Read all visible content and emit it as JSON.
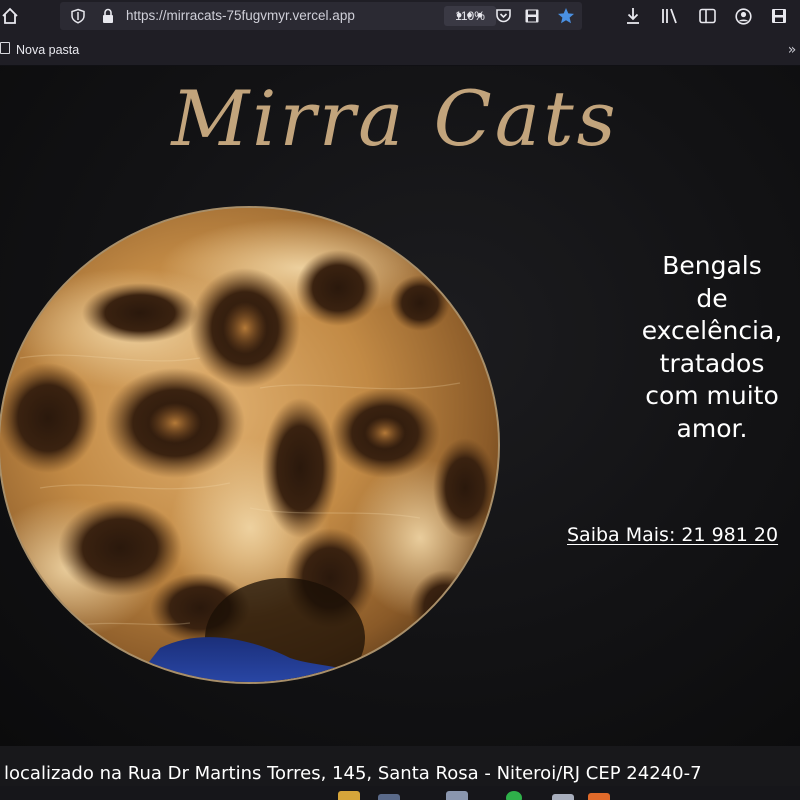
{
  "browser": {
    "url": "https://mirracats-75fugvmyr.vercel.app",
    "zoom": "110%",
    "bookmark_folder": "Nova pasta",
    "icons": [
      "home-icon",
      "shield-icon",
      "lock-icon",
      "more-icon",
      "pocket-icon",
      "save-icon",
      "star-icon",
      "download-icon",
      "library-icon",
      "sidebar-icon",
      "account-icon",
      "extension-icon"
    ]
  },
  "site": {
    "title": "Mirra Cats",
    "tagline": [
      "Bengals",
      "de",
      "excelência,",
      "tratados",
      "com muito",
      "amor."
    ],
    "cta_link": "Saiba Mais: 21 981 20",
    "footer_address": "localizado na Rua Dr Martins Torres, 145, Santa Rosa - Niteroi/RJ CEP 24240-7"
  },
  "colors": {
    "title_gold": "#c2a47c",
    "page_bg": "#121214",
    "chrome_bg": "#1f1e25",
    "star_blue": "#4a90e2",
    "text_white": "#ffffff"
  }
}
